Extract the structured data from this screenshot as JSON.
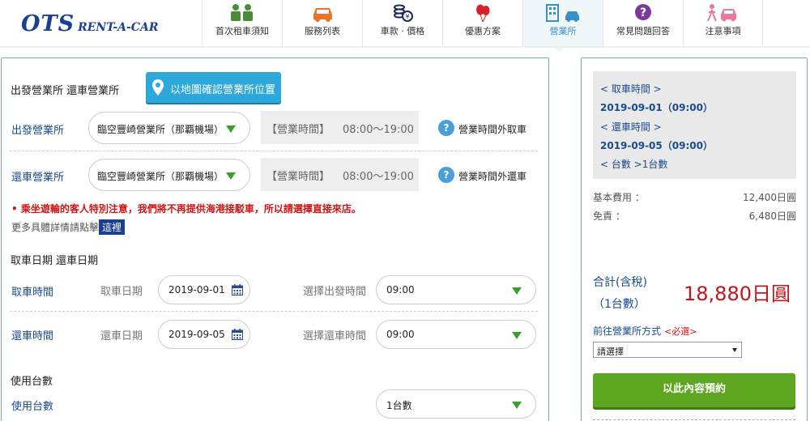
{
  "header": {
    "logo_main": "OTS",
    "logo_sub": "RENT-A-CAR",
    "nav": [
      {
        "label": "首次租車須知",
        "icon": "people-icon",
        "color": "#4a8c3a"
      },
      {
        "label": "服務列表",
        "icon": "car-icon",
        "color": "#e8742a"
      },
      {
        "label": "車款 · 價格",
        "icon": "coins-icon",
        "color": "#1a2a5a"
      },
      {
        "label": "優惠方案",
        "icon": "balloon-icon",
        "color": "#d8222a"
      },
      {
        "label": "營業所",
        "icon": "building-car-icon",
        "color": "#3a8fc8"
      },
      {
        "label": "常見問題回答",
        "icon": "question-icon",
        "color": "#7a3a9a"
      },
      {
        "label": "注意事項",
        "icon": "pedestrian-car-icon",
        "color": "#e87aa0"
      }
    ]
  },
  "office": {
    "title": "出發營業所 還車營業所",
    "map_button": "以地圖確認營業所位置",
    "depart": {
      "label": "出發營業所",
      "value": "臨空豐崎營業所（那覇機場）",
      "hours_label": "【營業時間】",
      "hours": "08:00〜19:00",
      "after_hours": "營業時間外取車"
    },
    "return": {
      "label": "還車營業所",
      "value": "臨空豐崎營業所（那覇機場）",
      "hours_label": "【營業時間】",
      "hours": "08:00〜19:00",
      "after_hours": "營業時間外還車"
    },
    "warning": "• 乘坐遊輪的客人特別注意，我們將不再提供海港接駁車，所以請選擇直接來店。",
    "more_text": "更多具體詳情請點擊",
    "more_link": "這裡"
  },
  "dates": {
    "title": "取車日期 還車日期",
    "pickup": {
      "label": "取車時間",
      "date_label": "取車日期",
      "date": "2019-09-01",
      "time_label": "選擇出發時間",
      "time": "09:00"
    },
    "dropoff": {
      "label": "還車時間",
      "date_label": "還車日期",
      "date": "2019-09-05",
      "time_label": "選擇還車時間",
      "time": "09:00"
    }
  },
  "cars": {
    "title": "使用台數",
    "label": "使用台數",
    "value": "1台數"
  },
  "summary": {
    "pickup_heading": "< 取車時間 >",
    "pickup_value": "2019-09-01（09:00）",
    "return_heading": "< 還車時間 >",
    "return_value": "2019-09-05（09:00）",
    "count_line": "< 台數 >1台數",
    "fees": [
      {
        "label": "基本費用 ：",
        "value": "12,400日圓"
      },
      {
        "label": "免責 ：",
        "value": "6,480日圓"
      }
    ],
    "total_label_1": "合計(含稅)",
    "total_label_2": "（1台數）",
    "total_value": "18,880日圓",
    "method_label": "前往營業所方式",
    "method_required": "<必選>",
    "method_select": "請選擇",
    "book_button": "以此內容預約"
  },
  "colors": {
    "brand": "#1b3f92",
    "accent_blue": "#2ca8da",
    "book_green": "#5da620",
    "price_red": "#c0161d",
    "warning_red": "#d01515"
  }
}
